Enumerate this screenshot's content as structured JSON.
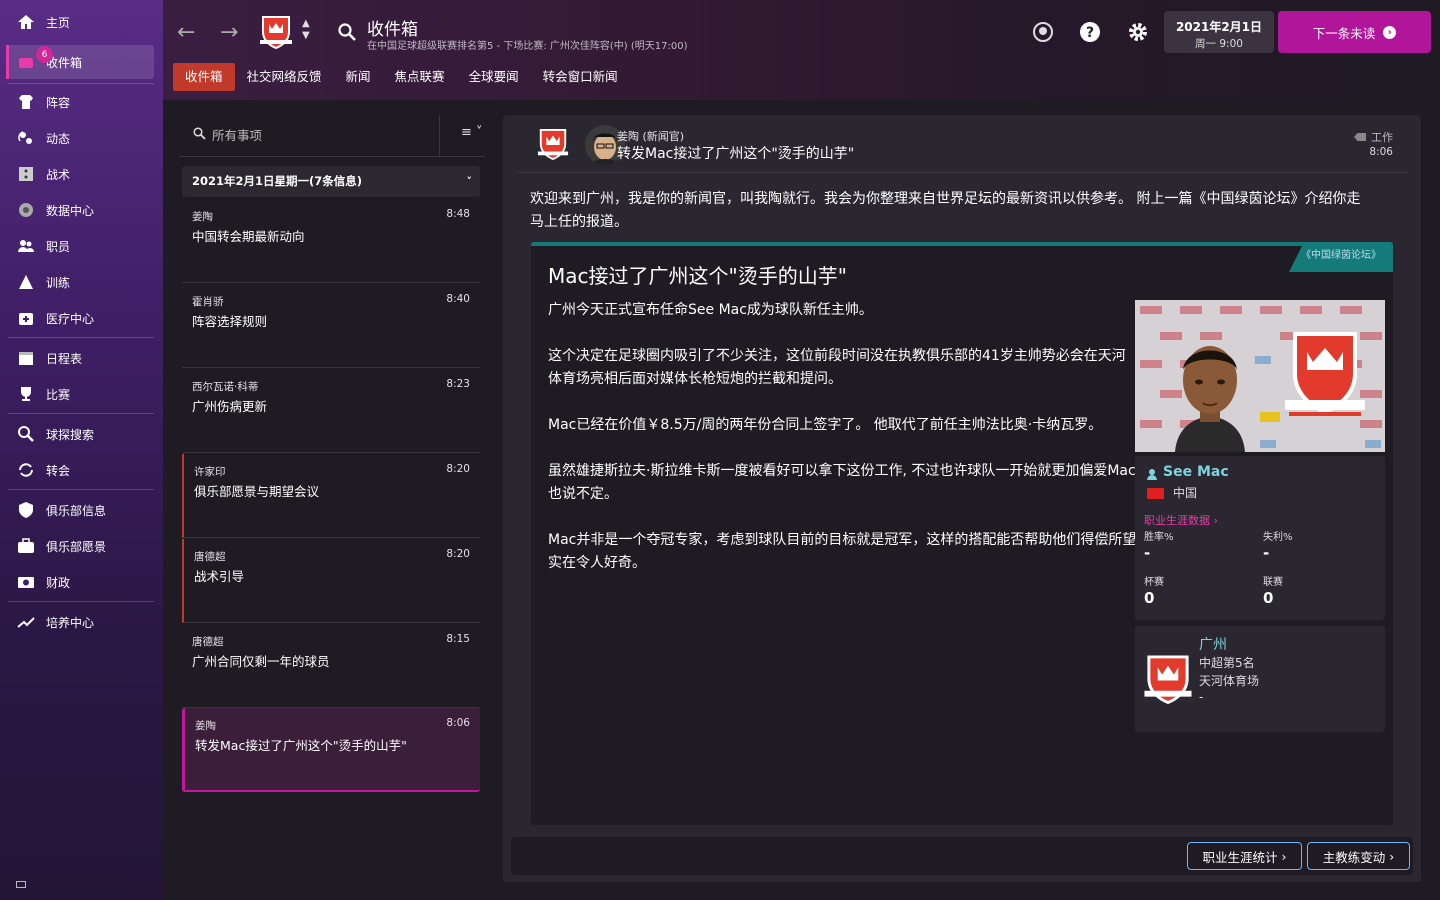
{
  "sidebar": {
    "items": [
      {
        "label": "主页",
        "icon": "home-icon"
      },
      {
        "label": "收件箱",
        "icon": "inbox-icon",
        "badge": "6"
      },
      {
        "label": "阵容",
        "icon": "shirt-icon"
      },
      {
        "label": "动态",
        "icon": "dynamics-icon"
      },
      {
        "label": "战术",
        "icon": "tactics-icon"
      },
      {
        "label": "数据中心",
        "icon": "data-hub-icon"
      },
      {
        "label": "职员",
        "icon": "staff-icon"
      },
      {
        "label": "训练",
        "icon": "training-icon"
      },
      {
        "label": "医疗中心",
        "icon": "medical-icon"
      },
      {
        "label": "日程表",
        "icon": "calendar-icon"
      },
      {
        "label": "比赛",
        "icon": "trophy-icon"
      },
      {
        "label": "球探搜索",
        "icon": "scouting-icon"
      },
      {
        "label": "转会",
        "icon": "transfers-icon"
      },
      {
        "label": "俱乐部信息",
        "icon": "shield-icon"
      },
      {
        "label": "俱乐部愿景",
        "icon": "briefcase-icon"
      },
      {
        "label": "财政",
        "icon": "finances-icon"
      },
      {
        "label": "培养中心",
        "icon": "development-icon"
      }
    ]
  },
  "header": {
    "title": "收件箱",
    "subtitle": "在中国足球超级联赛排名第5 - 下场比赛: 广州次佳阵容(中) (明天17:00)",
    "tabs": [
      "收件箱",
      "社交网络反馈",
      "新闻",
      "焦点联赛",
      "全球要闻",
      "转会窗口新闻"
    ],
    "date": "2021年2月1日",
    "day_time": "周一 9:00",
    "next_button": "下一条未读"
  },
  "inbox": {
    "search_placeholder": "所有事项",
    "group_header": "2021年2月1日星期一(7条信息)",
    "messages": [
      {
        "sender": "姜陶",
        "time": "8:48",
        "subject": "中国转会期最新动向"
      },
      {
        "sender": "霍肖骄",
        "time": "8:40",
        "subject": "阵容选择规则"
      },
      {
        "sender": "西尔瓦诺·科蒂",
        "time": "8:23",
        "subject": "广州伤病更新"
      },
      {
        "sender": "许家印",
        "time": "8:20",
        "subject": "俱乐部愿景与期望会议"
      },
      {
        "sender": "唐德超",
        "time": "8:20",
        "subject": "战术引导"
      },
      {
        "sender": "唐德超",
        "time": "8:15",
        "subject": "广州合同仅剩一年的球员"
      },
      {
        "sender": "姜陶",
        "time": "8:06",
        "subject": "转发Mac接过了广州这个\"烫手的山芋\""
      }
    ]
  },
  "message": {
    "sender": "姜陶 (新闻官)",
    "subject": "转发Mac接过了广州这个\"烫手的山芋\"",
    "category": "工作",
    "time": "8:06",
    "intro": "欢迎来到广州，我是你的新闻官，叫我陶就行。我会为你整理来自世界足坛的最新资讯以供参考。 附上一篇《中国绿茵论坛》介绍你走马上任的报道。",
    "article": {
      "source": "《中国绿茵论坛》",
      "title": "Mac接过了广州这个\"烫手的山芋\"",
      "paragraphs": [
        "广州今天正式宣布任命See Mac成为球队新任主帅。",
        "这个决定在足球圈内吸引了不少关注，这位前段时间没在执教俱乐部的41岁主帅势必会在天河体育场亮相后面对媒体长枪短炮的拦截和提问。",
        "Mac已经在价值￥8.5万/周的两年份合同上签字了。 他取代了前任主帅法比奥·卡纳瓦罗。",
        "虽然雄捷斯拉夫·斯拉维卡斯一度被看好可以拿下这份工作, 不过也许球队一开始就更加偏爱Mac也说不定。",
        "Mac并非是一个夺冠专家，考虑到球队目前的目标就是冠军，这样的搭配能否帮助他们得偿所望实在令人好奇。"
      ]
    },
    "manager": {
      "name": "See Mac",
      "nation": "中国",
      "career_link": "职业生涯数据",
      "stats": [
        {
          "label": "胜率%",
          "value": "-"
        },
        {
          "label": "失利%",
          "value": "-"
        },
        {
          "label": "杯赛",
          "value": "0"
        },
        {
          "label": "联赛",
          "value": "0"
        }
      ]
    },
    "club": {
      "name": "广州",
      "position": "中超第5名",
      "stadium": "天河体育场",
      "extra": "-"
    },
    "buttons": [
      "职业生涯统计",
      "主教练变动"
    ]
  },
  "colors": {
    "accent": "#b0159a",
    "tab_active": "#c0392b",
    "article_stripe": "#147a7a",
    "link": "#7ed3e0"
  }
}
